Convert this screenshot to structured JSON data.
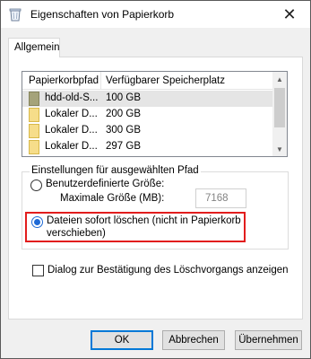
{
  "window": {
    "title": "Eigenschaften von Papierkorb",
    "icon": "recycle-bin-icon",
    "close_glyph": "✕"
  },
  "tab": {
    "label": "Allgemein"
  },
  "list": {
    "columns": [
      "Papierkorbpfad",
      "Verfügbarer Speicherplatz"
    ],
    "rows": [
      {
        "name": "hdd-old-S...",
        "size": "100 GB",
        "selected": true,
        "drive_color": "#a5a37a"
      },
      {
        "name": "Lokaler D...",
        "size": "200 GB",
        "selected": false,
        "drive_color": "#f6dd8a"
      },
      {
        "name": "Lokaler D...",
        "size": "300 GB",
        "selected": false,
        "drive_color": "#f6dd8a"
      },
      {
        "name": "Lokaler D...",
        "size": "297 GB",
        "selected": false,
        "drive_color": "#f6dd8a"
      }
    ]
  },
  "settings": {
    "group_label": "Einstellungen für ausgewählten Pfad",
    "custom_size_label": "Benutzerdefinierte Größe:",
    "custom_size_selected": false,
    "max_size_label": "Maximale Größe (MB):",
    "max_size_value": "7168",
    "delete_immediately_line1": "Dateien sofort löschen (nicht in Papierkorb",
    "delete_immediately_line2": "verschieben)",
    "delete_immediately_selected": true,
    "highlight_color": "#e21d1d"
  },
  "confirm": {
    "label": "Dialog zur Bestätigung des Löschvorgangs anzeigen",
    "checked": false
  },
  "buttons": {
    "ok": "OK",
    "cancel": "Abbrechen",
    "apply": "Übernehmen"
  }
}
